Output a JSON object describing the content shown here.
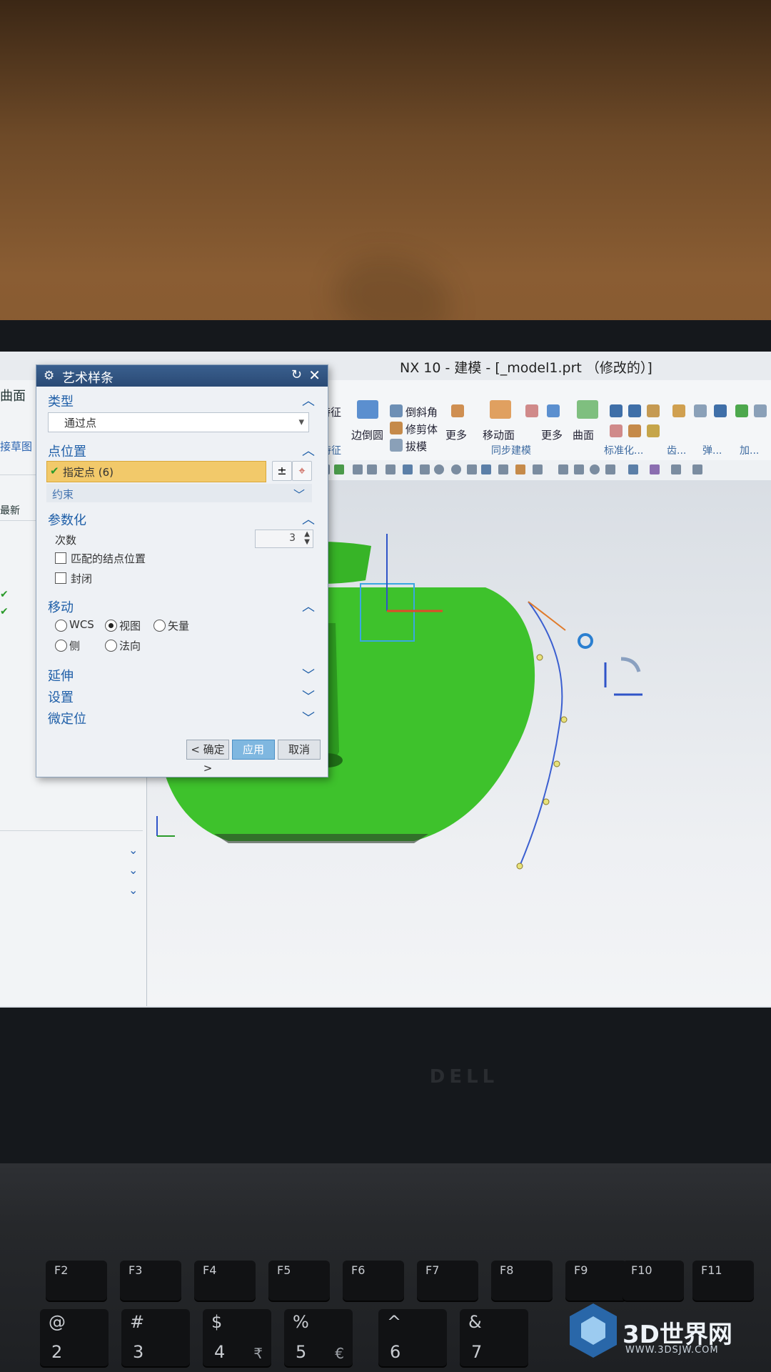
{
  "window": {
    "title": "NX 10 - 建模 - [_model1.prt （修改的）]"
  },
  "ribbon": {
    "items": [
      "特征",
      "边倒圆",
      "倒斜角",
      "修剪体",
      "拔模",
      "更多",
      "移动面",
      "更多",
      "曲面"
    ],
    "groups": [
      "特征",
      "同步建模",
      "标准化...",
      "齿...",
      "弹...",
      "加..."
    ]
  },
  "navigator": {
    "tab": "曲面",
    "link": "接草图",
    "latest": "最新"
  },
  "dialog": {
    "title": "艺术样条",
    "sections": {
      "type": {
        "label": "类型",
        "value": "通过点"
      },
      "point_position": {
        "label": "点位置",
        "selected": "指定点 (6)",
        "constraint_label": "约束"
      },
      "parameterization": {
        "label": "参数化",
        "degree_label": "次数",
        "degree_value": "3",
        "match_knots_label": "匹配的结点位置",
        "closed_label": "封闭"
      },
      "move": {
        "label": "移动",
        "options": [
          "WCS",
          "视图",
          "矢量",
          "侧",
          "法向"
        ],
        "selected": "视图"
      },
      "extend": {
        "label": "延伸"
      },
      "settings": {
        "label": "设置"
      },
      "fine_position": {
        "label": "微定位"
      }
    },
    "buttons": {
      "ok": "< 确定 >",
      "apply": "应用",
      "cancel": "取消"
    }
  },
  "keyboard": {
    "fkeys": [
      "F2",
      "F3",
      "F4",
      "F5",
      "F6",
      "F7",
      "F8",
      "F9",
      "F10",
      "F11"
    ],
    "numrow": [
      {
        "top": "@",
        "bottom": "2",
        "alt": ""
      },
      {
        "top": "#",
        "bottom": "3",
        "alt": ""
      },
      {
        "top": "$",
        "bottom": "4",
        "alt": "₹"
      },
      {
        "top": "%",
        "bottom": "5",
        "alt": "€"
      },
      {
        "top": "^",
        "bottom": "6",
        "alt": ""
      },
      {
        "top": "&",
        "bottom": "7",
        "alt": ""
      }
    ]
  },
  "watermark": {
    "name": "3D世界网",
    "url": "WWW.3DSJW.COM"
  },
  "colors": {
    "model_green": "#3ec22c",
    "dialog_title": "#2f5282",
    "highlight": "#f2c96a",
    "apply_button": "#7fb7e0"
  }
}
